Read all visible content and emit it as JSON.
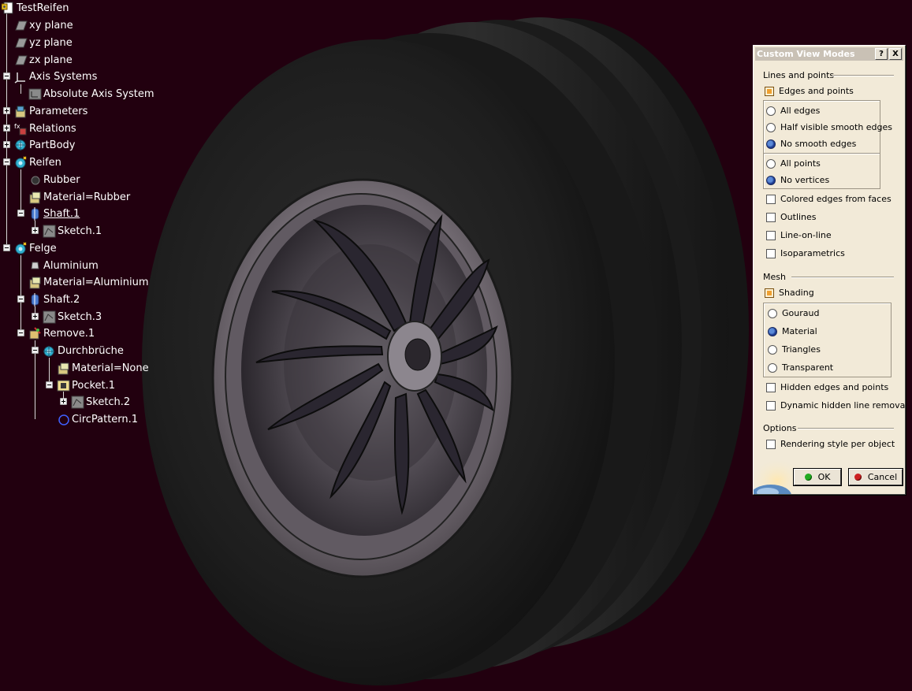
{
  "tree": {
    "items": [
      {
        "label": "TestReifen",
        "icon": "part-document-icon"
      },
      {
        "label": "xy plane",
        "icon": "plane-icon"
      },
      {
        "label": "yz plane",
        "icon": "plane-icon"
      },
      {
        "label": "zx plane",
        "icon": "plane-icon"
      },
      {
        "label": "Axis Systems",
        "icon": "axis-systems-icon"
      },
      {
        "label": "Absolute Axis System",
        "icon": "axis-system-icon"
      },
      {
        "label": "Parameters",
        "icon": "parameters-icon"
      },
      {
        "label": "Relations",
        "icon": "relations-icon"
      },
      {
        "label": "PartBody",
        "icon": "body-icon"
      },
      {
        "label": "Reifen",
        "icon": "body-icon"
      },
      {
        "label": "Rubber",
        "icon": "material-sphere-icon"
      },
      {
        "label": "Material=Rubber",
        "icon": "material-parameter-icon"
      },
      {
        "label": "Shaft.1",
        "icon": "shaft-icon"
      },
      {
        "label": "Sketch.1",
        "icon": "sketch-icon"
      },
      {
        "label": "Felge",
        "icon": "body-icon"
      },
      {
        "label": "Aluminium",
        "icon": "material-sphere-icon"
      },
      {
        "label": "Material=Aluminium",
        "icon": "material-parameter-icon"
      },
      {
        "label": "Shaft.2",
        "icon": "shaft-icon"
      },
      {
        "label": "Sketch.3",
        "icon": "sketch-icon"
      },
      {
        "label": "Remove.1",
        "icon": "remove-icon"
      },
      {
        "label": "Durchbrüche",
        "icon": "body-icon"
      },
      {
        "label": "Material=None",
        "icon": "material-parameter-icon"
      },
      {
        "label": "Pocket.1",
        "icon": "pocket-icon"
      },
      {
        "label": "Sketch.2",
        "icon": "sketch-icon"
      },
      {
        "label": "CircPattern.1",
        "icon": "circ-pattern-icon"
      }
    ]
  },
  "dialog": {
    "title": "Custom View Modes",
    "help_button": "?",
    "close_button": "X",
    "lines_section": "Lines and points",
    "edges_points": {
      "label": "Edges and points",
      "checked": true
    },
    "edge_options": [
      {
        "label": "All edges",
        "selected": false
      },
      {
        "label": "Half visible smooth edges",
        "selected": false
      },
      {
        "label": "No smooth edges",
        "selected": true
      }
    ],
    "point_options": [
      {
        "label": "All points",
        "selected": false
      },
      {
        "label": "No vertices",
        "selected": true
      }
    ],
    "colored_edges": {
      "label": "Colored edges from faces",
      "checked": false
    },
    "outlines": {
      "label": "Outlines",
      "checked": false
    },
    "line_on_line": {
      "label": "Line-on-line",
      "checked": false
    },
    "isoparametrics": {
      "label": "Isoparametrics",
      "checked": false
    },
    "mesh_section": "Mesh",
    "shading": {
      "label": "Shading",
      "checked": true
    },
    "shading_options": [
      {
        "label": "Gouraud",
        "selected": false
      },
      {
        "label": "Material",
        "selected": true
      },
      {
        "label": "Triangles",
        "selected": false
      },
      {
        "label": "Transparent",
        "selected": false
      }
    ],
    "hidden_edges": {
      "label": "Hidden edges and points",
      "checked": false
    },
    "dynamic_hidden": {
      "label": "Dynamic hidden line removal",
      "checked": false
    },
    "options_section": "Options",
    "rendering_style": {
      "label": "Rendering style per object",
      "checked": false
    },
    "ok_label": "OK",
    "cancel_label": "Cancel"
  },
  "colors": {
    "background": "#22000f",
    "tree_text": "#ffffff",
    "dialog_bg": "#f2ead8",
    "ok_dot": "#22aa22",
    "cancel_dot": "#cc2222"
  }
}
